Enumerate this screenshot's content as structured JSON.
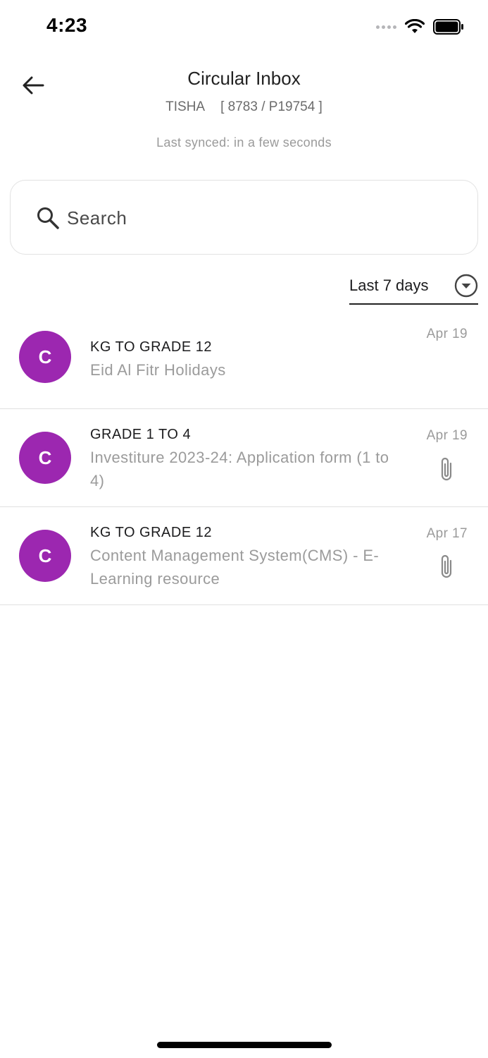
{
  "status_bar": {
    "time": "4:23"
  },
  "header": {
    "title": "Circular Inbox",
    "student_name": "TISHA",
    "student_id": "[ 8783 / P19754 ]",
    "sync_status": "Last synced: in a few seconds"
  },
  "search": {
    "placeholder": "Search",
    "value": ""
  },
  "filter": {
    "selected": "Last 7 days"
  },
  "circulars": [
    {
      "avatar": "C",
      "category": "KG TO GRADE 12",
      "subject": "Eid Al Fitr Holidays",
      "date": "Apr 19",
      "has_attachment": false
    },
    {
      "avatar": "C",
      "category": "GRADE 1 TO 4",
      "subject": "Investiture 2023-24: Application form (1 to 4)",
      "date": "Apr 19",
      "has_attachment": true
    },
    {
      "avatar": "C",
      "category": "KG TO GRADE 12",
      "subject": "Content Management System(CMS) - E-Learning resource",
      "date": "Apr 17",
      "has_attachment": true
    }
  ],
  "colors": {
    "avatar": "#9c27b0",
    "muted_text": "#9b9b9b",
    "divider": "#e0e0e0"
  },
  "icons": [
    "back-arrow-icon",
    "search-icon",
    "chevron-down-icon",
    "attachment-icon",
    "wifi-icon",
    "battery-icon"
  ]
}
